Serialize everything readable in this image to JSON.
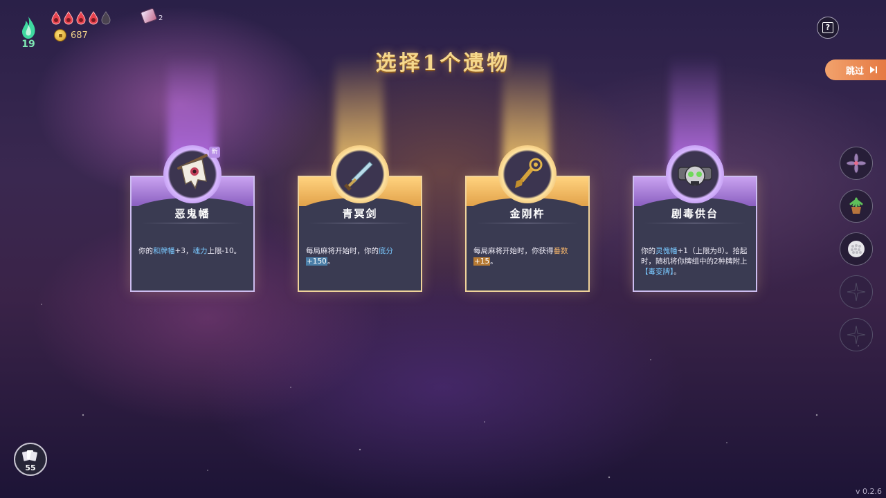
{
  "hud": {
    "level": "19",
    "hearts_full": 4,
    "hearts_total": 5,
    "coins": "687",
    "tiles_count": "2"
  },
  "title": "选择1个遗物",
  "skip_label": "跳过",
  "new_badge": "新",
  "relics": [
    {
      "name": "恶鬼幡",
      "rarity": "rare",
      "icon": "banner-icon",
      "desc_parts": [
        {
          "t": "你的",
          "s": ""
        },
        {
          "t": "和牌幡",
          "s": "hl"
        },
        {
          "t": "+3，",
          "s": ""
        },
        {
          "t": "魂力",
          "s": "hl"
        },
        {
          "t": "上限-10。",
          "s": ""
        }
      ]
    },
    {
      "name": "青冥剑",
      "rarity": "gold",
      "icon": "sword-icon",
      "desc_parts": [
        {
          "t": "每局麻将开始时，你的",
          "s": ""
        },
        {
          "t": "底分",
          "s": "hl"
        },
        {
          "t": "+150",
          "s": "hl-bg"
        },
        {
          "t": "。",
          "s": ""
        }
      ]
    },
    {
      "name": "金刚杵",
      "rarity": "gold",
      "icon": "vajra-icon",
      "desc_parts": [
        {
          "t": "每局麻将开始时，你获得",
          "s": ""
        },
        {
          "t": "番数",
          "s": "hl-o"
        },
        {
          "t": "+15",
          "s": "hl-obg"
        },
        {
          "t": "。",
          "s": ""
        }
      ]
    },
    {
      "name": "剧毒供台",
      "rarity": "rare",
      "icon": "poison-skull-icon",
      "desc_parts": [
        {
          "t": "你的",
          "s": ""
        },
        {
          "t": "灵傀幡",
          "s": "hl"
        },
        {
          "t": "+1（上限为8）。",
          "s": ""
        },
        {
          "t": "拾起时，随机将你牌组中的2种牌附上",
          "s": ""
        },
        {
          "t": "【毒变牌】",
          "s": "hl"
        },
        {
          "t": "。",
          "s": ""
        }
      ]
    }
  ],
  "sidebar_slots": [
    {
      "icon": "lotus-icon",
      "filled": true
    },
    {
      "icon": "potted-plant-icon",
      "filled": true
    },
    {
      "icon": "rice-bowl-icon",
      "filled": true
    },
    {
      "icon": "empty-slot-icon",
      "filled": false
    },
    {
      "icon": "empty-slot-icon",
      "filled": false
    }
  ],
  "deck_count": "55",
  "version": "v 0.2.6",
  "colors": {
    "accent_gold": "#f6d88c",
    "rare_purple": "#c9a2f0",
    "skip_orange": "#e47640",
    "level_green": "#7ee8b4"
  }
}
